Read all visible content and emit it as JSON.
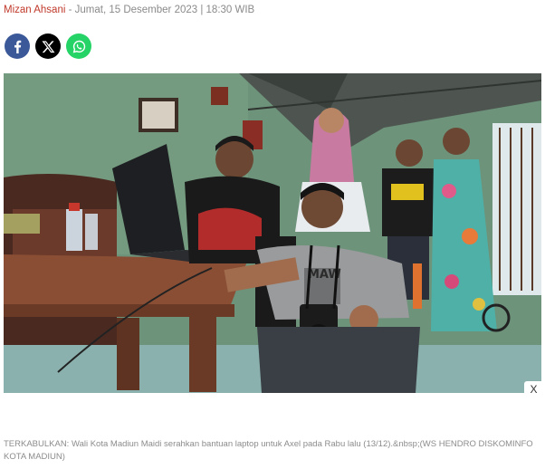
{
  "article": {
    "author": "Mizan Ahsani",
    "separator": " - ",
    "datetime": "Jumat, 15 Desember 2023 | 18:30 WIB"
  },
  "share": {
    "buttons": [
      {
        "name": "facebook",
        "icon": "facebook-icon",
        "color": "#3b5998"
      },
      {
        "name": "x",
        "icon": "x-icon",
        "color": "#000000"
      },
      {
        "name": "whatsapp",
        "icon": "whatsapp-icon",
        "color": "#25d366"
      }
    ]
  },
  "photo": {
    "close_label": "X",
    "shirt_print": "MAW"
  },
  "caption": {
    "text": "TERKABULKAN: Wali Kota Madiun Maidi serahkan bantuan laptop untuk Axel pada Rabu lalu (13/12).&nbsp;(WS HENDRO DISKOMINFO KOTA MADIUN)"
  }
}
